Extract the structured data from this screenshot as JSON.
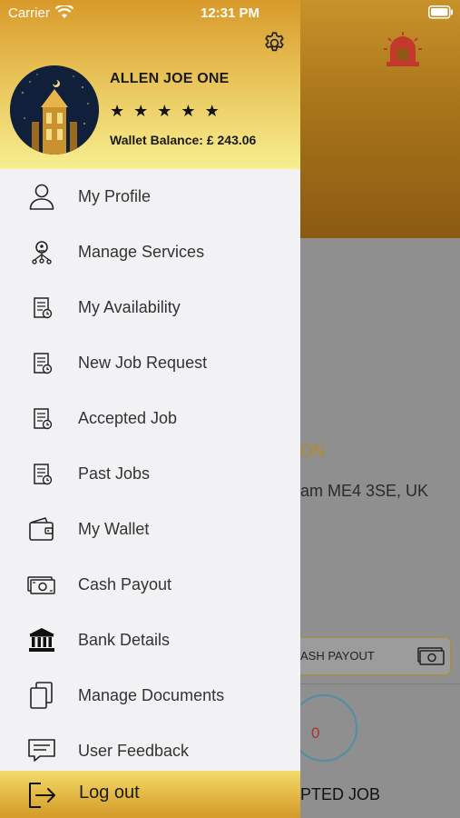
{
  "status_bar": {
    "carrier": "Carrier",
    "time": "12:31 PM"
  },
  "drawer": {
    "user_name": "ALLEN JOE ONE",
    "rating_stars": 5,
    "stars": [
      "★",
      "★",
      "★",
      "★",
      "★"
    ],
    "wallet_balance": "Wallet Balance: £ 243.06",
    "menu": [
      {
        "label": "My Profile",
        "icon": "user-icon"
      },
      {
        "label": "Manage Services",
        "icon": "services-icon"
      },
      {
        "label": "My Availability",
        "icon": "availability-icon"
      },
      {
        "label": "New Job Request",
        "icon": "job-request-icon"
      },
      {
        "label": "Accepted Job",
        "icon": "accepted-job-icon"
      },
      {
        "label": "Past Jobs",
        "icon": "past-jobs-icon"
      },
      {
        "label": "My Wallet",
        "icon": "wallet-icon"
      },
      {
        "label": "Cash Payout",
        "icon": "cash-icon"
      },
      {
        "label": "Bank Details",
        "icon": "bank-icon"
      },
      {
        "label": "Manage Documents",
        "icon": "documents-icon"
      },
      {
        "label": "User Feedback",
        "icon": "feedback-icon"
      }
    ],
    "logout_label": "Log out"
  },
  "background": {
    "partial_heading": "ON",
    "partial_address": "am ME4 3SE, UK",
    "cash_payout_button": "ASH PAYOUT",
    "count": "0",
    "accepted_label": "PTED JOB"
  },
  "colors": {
    "accent_gold": "#d89a2a",
    "header_light": "#f7ee8f",
    "alarm_red": "#c0392b",
    "count_red": "#b03030"
  }
}
